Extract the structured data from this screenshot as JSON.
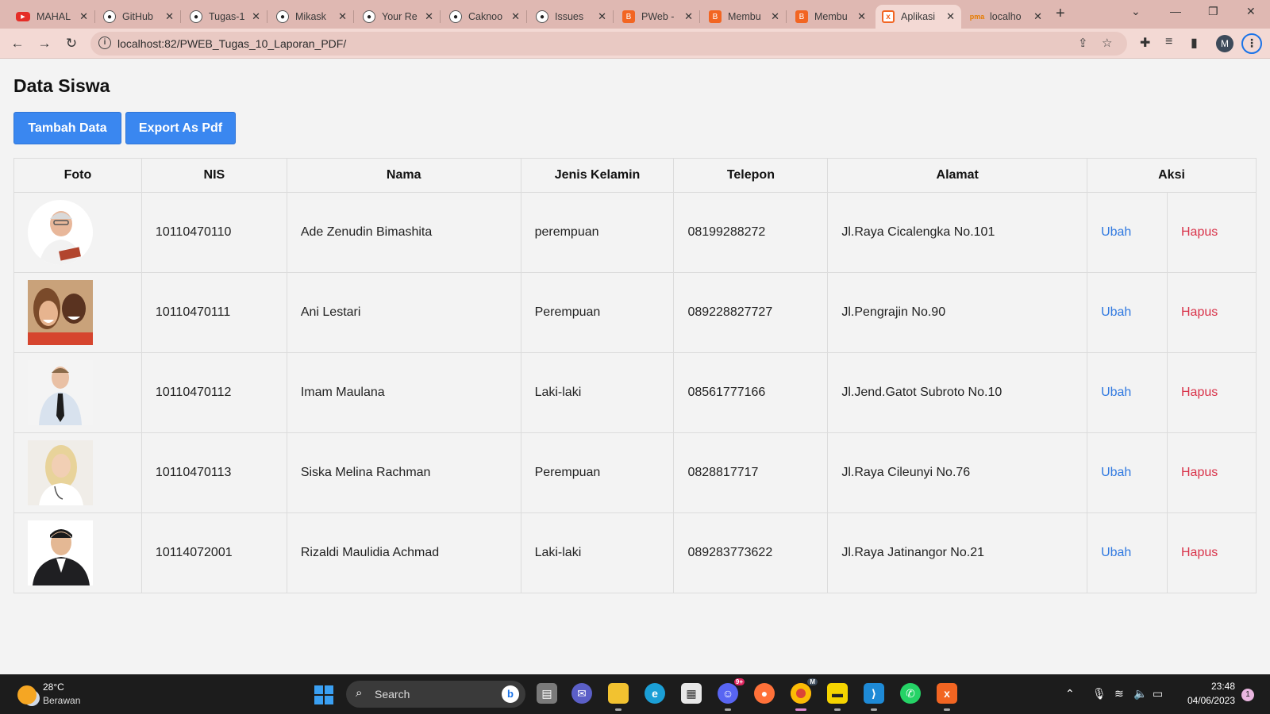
{
  "browser": {
    "tabs": [
      {
        "title": "MAHAL",
        "icon": "youtube-icon",
        "active": false
      },
      {
        "title": "GitHub",
        "icon": "github-icon",
        "active": false
      },
      {
        "title": "Tugas-1",
        "icon": "github-icon",
        "active": false
      },
      {
        "title": "Mikask",
        "icon": "github-icon",
        "active": false
      },
      {
        "title": "Your Re",
        "icon": "github-icon",
        "active": false
      },
      {
        "title": "Caknoo",
        "icon": "github-icon",
        "active": false
      },
      {
        "title": "Issues",
        "icon": "github-icon",
        "active": false
      },
      {
        "title": "PWeb -",
        "icon": "blogger-icon",
        "active": false
      },
      {
        "title": "Membu",
        "icon": "blogger-icon",
        "active": false
      },
      {
        "title": "Membu",
        "icon": "blogger-icon",
        "active": false
      },
      {
        "title": "Aplikasi",
        "icon": "xampp-icon",
        "active": true
      },
      {
        "title": "localho",
        "icon": "phpmyadmin-icon",
        "active": false
      }
    ],
    "url": "localhost:82/PWEB_Tugas_10_Laporan_PDF/",
    "profile_initial": "M"
  },
  "page": {
    "title": "Data Siswa",
    "buttons": {
      "add": "Tambah Data",
      "export": "Export As Pdf"
    },
    "table": {
      "headers": {
        "foto": "Foto",
        "nis": "NIS",
        "nama": "Nama",
        "jenis_kelamin": "Jenis Kelamin",
        "telepon": "Telepon",
        "alamat": "Alamat",
        "aksi": "Aksi"
      },
      "rows": [
        {
          "nis": "10110470110",
          "nama": "Ade Zenudin Bimashita",
          "jenis_kelamin": "perempuan",
          "telepon": "08199288272",
          "alamat": "Jl.Raya Cicalengka No.101",
          "edit": "Ubah",
          "delete": "Hapus"
        },
        {
          "nis": "10110470111",
          "nama": "Ani Lestari",
          "jenis_kelamin": "Perempuan",
          "telepon": "089228827727",
          "alamat": "Jl.Pengrajin No.90",
          "edit": "Ubah",
          "delete": "Hapus"
        },
        {
          "nis": "10110470112",
          "nama": "Imam Maulana",
          "jenis_kelamin": "Laki-laki",
          "telepon": "08561777166",
          "alamat": "Jl.Jend.Gatot Subroto No.10",
          "edit": "Ubah",
          "delete": "Hapus"
        },
        {
          "nis": "10110470113",
          "nama": "Siska Melina Rachman",
          "jenis_kelamin": "Perempuan",
          "telepon": "0828817717",
          "alamat": "Jl.Raya Cileunyi No.76",
          "edit": "Ubah",
          "delete": "Hapus"
        },
        {
          "nis": "10114072001",
          "nama": "Rizaldi Maulidia Achmad",
          "jenis_kelamin": "Laki-laki",
          "telepon": "089283773622",
          "alamat": "Jl.Raya Jatinangor No.21",
          "edit": "Ubah",
          "delete": "Hapus"
        }
      ]
    }
  },
  "taskbar": {
    "weather_temp": "28°C",
    "weather_desc": "Berawan",
    "search_label": "Search",
    "discord_badge": "9+",
    "chrome_badge": "M",
    "time": "23:48",
    "date": "04/06/2023",
    "notification_count": "1"
  },
  "colors": {
    "primary_button": "#3a87f0",
    "link_edit": "#2f78e0",
    "link_delete": "#d9334a",
    "tab_strip": "#dfb8b2",
    "taskbar": "#1c1c1c"
  }
}
